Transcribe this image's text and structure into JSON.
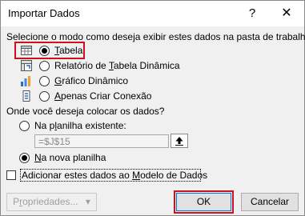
{
  "window": {
    "title": "Importar Dados",
    "help_glyph": "?",
    "close_glyph": "✕"
  },
  "view_section": {
    "instruction": "Selecione o modo como deseja exibir estes dados na pasta de trabalho.",
    "options": [
      {
        "pre": "",
        "mnemonic": "T",
        "post": "abela",
        "selected": true,
        "icon": "table-icon"
      },
      {
        "pre": "Relatório de ",
        "mnemonic": "T",
        "post": "abela Dinâmica",
        "selected": false,
        "icon": "pivot-table-icon"
      },
      {
        "pre": "",
        "mnemonic": "G",
        "post": "ráfico Dinâmico",
        "selected": false,
        "icon": "pivot-chart-icon"
      },
      {
        "pre": "",
        "mnemonic": "A",
        "post": "penas Criar Conexão",
        "selected": false,
        "icon": "connection-icon"
      }
    ]
  },
  "location_section": {
    "question": "Onde você deseja colocar os dados?",
    "existing_sheet": {
      "pre": "Na p",
      "mnemonic": "l",
      "post": "anilha existente:",
      "selected": false
    },
    "reference_value": "=$J$15",
    "new_sheet": {
      "pre": "",
      "mnemonic": "N",
      "post": "a nova planilha",
      "selected": true
    }
  },
  "data_model_checkbox": {
    "pre": "Adicionar estes dados ao ",
    "mnemonic": "M",
    "post": "odelo de Dados",
    "checked": false
  },
  "buttons": {
    "properties": {
      "pre": "P",
      "mnemonic": "r",
      "post": "opriedades...",
      "arrow": "▾"
    },
    "ok": "OK",
    "cancel": "Cancelar"
  },
  "colors": {
    "highlight": "#d10f1e",
    "focus_blue": "#0078d7"
  }
}
